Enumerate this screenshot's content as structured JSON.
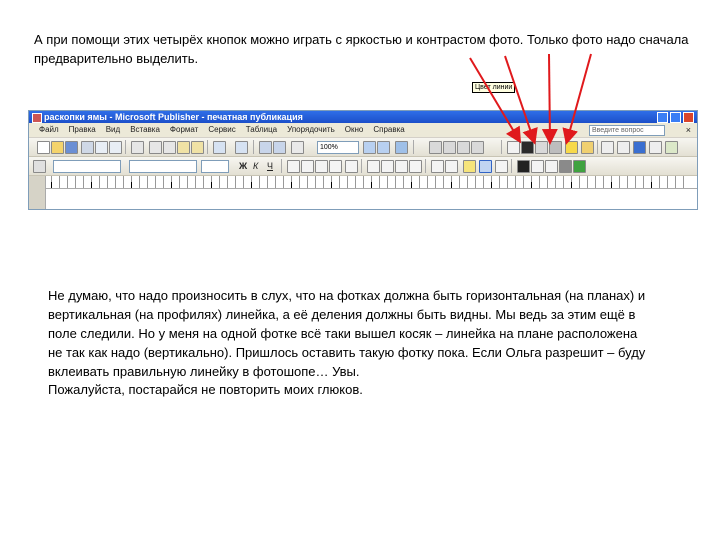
{
  "text": {
    "top": "А при помощи этих четырёх кнопок можно играть с яркостью и контрастом фото. Только фото надо сначала предварительно выделить.",
    "body1": "Не думаю, что надо произносить в слух, что на фотках должна быть горизонтальная (на планах) и вертикальная (на профилях) линейка, а её деления должны быть видны. Мы ведь за этим ещё в поле следили. Но у меня на одной фотке всё таки вышел косяк – линейка на плане расположена не так как надо (вертикально). Пришлось оставить такую фотку пока. Если Ольга разрешит – буду вклеивать правильную линейку в фотошопе… Увы.",
    "body2": "Пожалуйста, постарайся не повторить моих глюков."
  },
  "app": {
    "title": "раскопки ямы - Microsoft Publisher - печатная публикация",
    "menu": [
      "Файл",
      "Правка",
      "Вид",
      "Вставка",
      "Формат",
      "Сервис",
      "Таблица",
      "Упорядочить",
      "Окно",
      "Справка"
    ],
    "ask_placeholder": "Введите вопрос",
    "zoom": "100%",
    "tooltip": "Цвет линии",
    "format_labels": [
      "Ж",
      "К",
      "Ч"
    ]
  },
  "colors": {
    "arrow": "#e0191c",
    "titlebar": "#2f6ee8"
  }
}
